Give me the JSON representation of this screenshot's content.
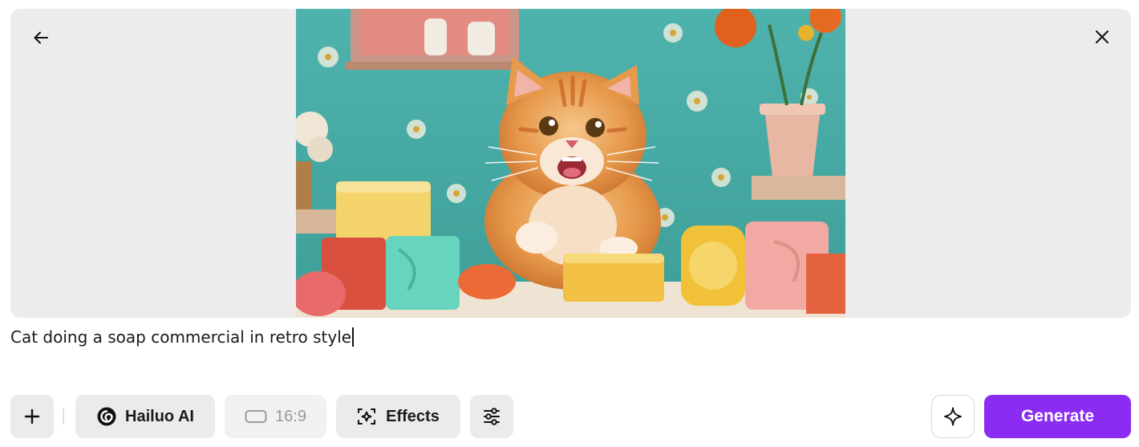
{
  "preview": {
    "image_alt": "Orange kitten among soap bars on teal flowered background",
    "back_icon": "arrow-left-icon",
    "close_icon": "close-icon"
  },
  "prompt": {
    "text": "Cat doing a soap commercial in retro style"
  },
  "toolbar": {
    "add_icon": "plus-icon",
    "model_label": "Hailuo AI",
    "model_icon": "hailuo-spiral-icon",
    "aspect_ratio_label": "16:9",
    "aspect_ratio_icon": "rectangle-icon",
    "effects_label": "Effects",
    "effects_icon": "effects-frame-icon",
    "settings_icon": "sliders-icon",
    "enhance_icon": "sparkle-icon",
    "generate_label": "Generate"
  },
  "colors": {
    "accent": "#8a2cf2",
    "preview_bg": "#ececec",
    "button_bg": "#ebebeb"
  }
}
